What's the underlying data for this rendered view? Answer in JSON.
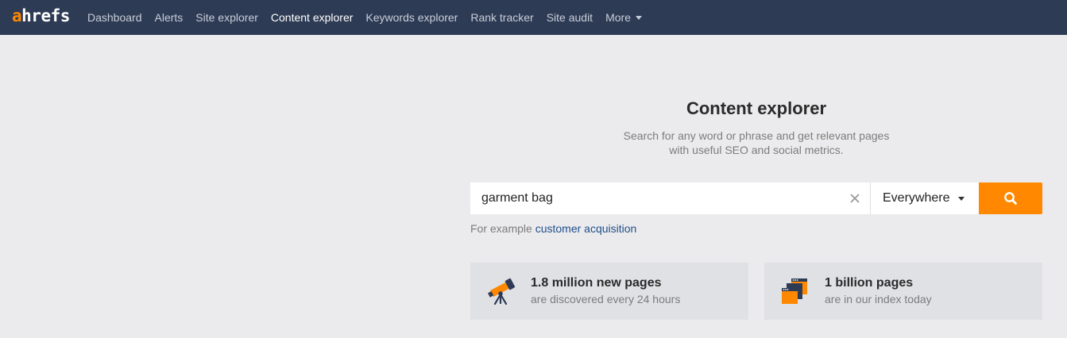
{
  "app": {
    "logo_prefix": "a",
    "logo_rest": "hrefs"
  },
  "nav": {
    "items": [
      {
        "label": "Dashboard",
        "active": false
      },
      {
        "label": "Alerts",
        "active": false
      },
      {
        "label": "Site explorer",
        "active": false
      },
      {
        "label": "Content explorer",
        "active": true
      },
      {
        "label": "Keywords explorer",
        "active": false
      },
      {
        "label": "Rank tracker",
        "active": false
      },
      {
        "label": "Site audit",
        "active": false
      }
    ],
    "more_label": "More"
  },
  "main": {
    "title": "Content explorer",
    "subtitle_line1": "Search for any word or phrase and get relevant pages",
    "subtitle_line2": "with useful SEO and social metrics."
  },
  "search": {
    "value": "garment bag",
    "scope": "Everywhere",
    "clear_icon": "close-icon",
    "button_icon": "search-icon"
  },
  "example": {
    "prefix": "For example",
    "link": "customer acquisition"
  },
  "stats": [
    {
      "title": "1.8 million new pages",
      "subtitle": "are discovered every 24 hours",
      "icon": "telescope-icon"
    },
    {
      "title": "1 billion pages",
      "subtitle": "are in our index today",
      "icon": "browser-pages-icon"
    }
  ],
  "colors": {
    "topbar": "#2e3b55",
    "accent": "#ff8800",
    "link": "#1f4f8b",
    "background": "#ebebed"
  }
}
